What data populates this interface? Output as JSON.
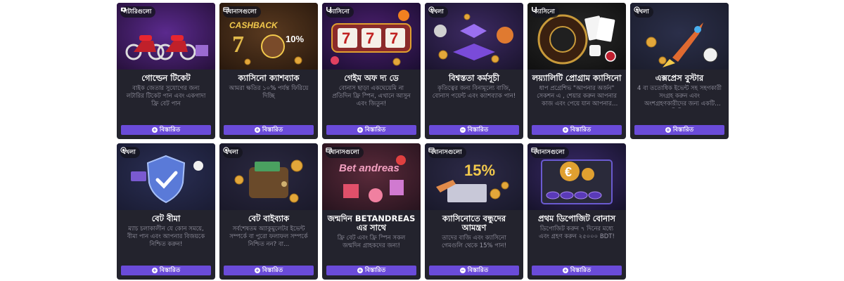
{
  "colors": {
    "card_bg": "#23232d",
    "button": "#6a4bd9",
    "desc": "#9b9aa8"
  },
  "cards": [
    {
      "tag": "লটারিগুলো",
      "tag_icon": "lottery-icon",
      "title": "গোল্ডেন টিকেট",
      "desc": "বাইক জেতার সুযোগের জন্য লটারির টিকেট পান এবং একগাদা ফ্রি বেট পান",
      "button": "বিস্তারিত",
      "button_icon": "plus-icon",
      "art": "motorbikes"
    },
    {
      "tag": "বোনাসগুলো",
      "tag_icon": "bonus-icon",
      "title": "ক্যাসিনো ক্যাশব্যাক",
      "desc": "আমরা ক্ষতির ১০% পর্যন্ত ফিরিয়ে দিচ্ছি",
      "button": "বিস্তারিত",
      "button_icon": "plus-icon",
      "art": "cashback"
    },
    {
      "tag": "ক্যাসিনো",
      "tag_icon": "horseshoe-icon",
      "title": "গেইম অফ দ্য ডে",
      "desc": "বোনাস ছাড়া একঘেয়েমি না প্রতিদিন ফ্রি স্পিন, এখানে আসুন এবং জিতুন!",
      "button": "বিস্তারিত",
      "button_icon": "plus-icon",
      "art": "slot"
    },
    {
      "tag": "খেলা",
      "tag_icon": "ball-icon",
      "title": "বিশ্বস্ততা কর্মসূচী",
      "desc": "কৃতিত্বের জন্য বিনামূল্যে বাজি, বোনাস পয়েন্ট এবং ক্যাশব্যাক পান!",
      "button": "বিস্তারিত",
      "button_icon": "minus-icon",
      "art": "gift"
    },
    {
      "tag": "ক্যাসিনো",
      "tag_icon": "horseshoe-icon",
      "title": "লয়্যালিটি প্রোগ্রাম ক্যাসিনো",
      "desc": "ধাপ প্রগ্রেশিভ \"আপনার অর্জন\" সেকশন এ , শেয়ার করুন আপনার কাজ এবং পেয়ে যান আপনার জন...",
      "button": "বিস্তারিত",
      "button_icon": "plus-icon",
      "art": "roulette"
    },
    {
      "tag": "খেলা",
      "tag_icon": "ball-icon",
      "title": "এক্সপ্রেস বুস্টার",
      "desc": "4 বা ততোধিক ইভেন্ট সহ সহগকারী সংগ্রহ করুন এবং অংশগ্রহণকারীদের জন্য একটি অতিরিক...",
      "button": "বিস্তারিত",
      "button_icon": "plus-icon",
      "art": "rocket"
    },
    {
      "tag": "খেলা",
      "tag_icon": "ball-icon",
      "title": "বেট বীমা",
      "desc": "ম্যাচ চলাকালীন যে কোন সময়ে, বীমা পান এবং আপনার বিজয়কে নিশ্চিত করুন!",
      "button": "বিস্তারিত",
      "button_icon": "plus-icon",
      "art": "shield"
    },
    {
      "tag": "খেলা",
      "tag_icon": "ball-icon",
      "title": "বেট বাইব্যাক",
      "desc": "সর্বশেষতম অ্যাকুমুলেটর ইভেন্ট সম্পর্কে বা পুরো ফলাফল সম্পর্কে নিশ্চিত নন? বা...",
      "button": "বিস্তারিত",
      "button_icon": "plus-icon",
      "art": "wallet"
    },
    {
      "tag": "বোনাসগুলো",
      "tag_icon": "bonus-icon",
      "title": "জন্মদিন BETANDREAS এর সাথে",
      "desc": "ফ্রি বেট এবং ফ্রি স্পিন সকল জন্মদিন গ্রাহকদের জন্য!",
      "button": "বিস্তারিত",
      "button_icon": "plus-icon",
      "art": "birthday",
      "art_text": "Bet andreas"
    },
    {
      "tag": "বোনাসগুলো",
      "tag_icon": "bonus-icon",
      "title": "ক্যাসিনোতে বন্ধুদের আমন্ত্রণ",
      "desc": "তাদের বাজি এবং ক্যাসিনো গেমগুলি থেকে 15% পান!",
      "button": "বিস্তারিত",
      "button_icon": "minus-icon",
      "art": "friends",
      "art_text": "15%"
    },
    {
      "tag": "বোনাসগুলো",
      "tag_icon": "bonus-icon",
      "title": "প্রথম ডিপোজিট বোনাস",
      "desc": "ডিপোজিট করুন ৭ দিনের মধ্যে এবং গ্রহণ করুন ২৫০০০ BDT!",
      "button": "বিস্তারিত",
      "button_icon": "plus-icon",
      "art": "euro"
    }
  ],
  "art_labels": {
    "cashback": "CASHBACK",
    "cashback_pct": "10%",
    "slot_digits": "777"
  }
}
